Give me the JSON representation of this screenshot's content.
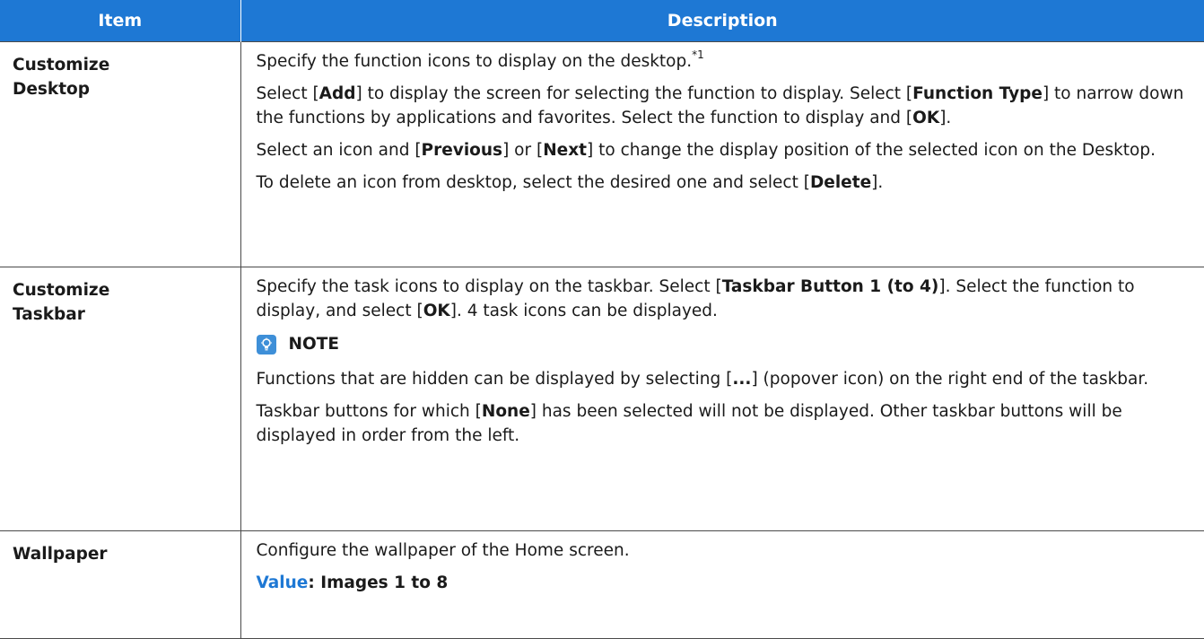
{
  "colors": {
    "header_bg": "#1e78d4",
    "value_label": "#1e78d4"
  },
  "header": {
    "item": "Item",
    "description": "Description"
  },
  "rows": [
    {
      "item_line1": "Customize",
      "item_line2": "Desktop",
      "p1": "Specify the function icons to display on the desktop.",
      "p1_sup": "*1",
      "p2_a": "Select [",
      "p2_b": "Add",
      "p2_c": "] to display the screen for selecting the function to display. Select [",
      "p2_d": "Function Type",
      "p2_e": "] to narrow down the functions by applications and favorites. Select the function to display and [",
      "p2_f": "OK",
      "p2_g": "].",
      "p3_a": "Select an icon and [",
      "p3_b": "Previous",
      "p3_c": "] or [",
      "p3_d": "Next",
      "p3_e": "] to change the display position of the selected icon on the Desktop.",
      "p4_a": "To delete an icon from desktop, select the desired one and select [",
      "p4_b": "Delete",
      "p4_c": "]."
    },
    {
      "item_line1": "Customize",
      "item_line2": "Taskbar",
      "p1_a": "Specify the task icons to display on the taskbar. Select [",
      "p1_b": "Taskbar Button 1 (to 4)",
      "p1_c": "]. Select the function to display, and select [",
      "p1_d": "OK",
      "p1_e": "]. 4 task icons can be displayed.",
      "note_icon": "lightbulb-note-icon",
      "note_label": "NOTE",
      "n1_a": "Functions that are hidden can be displayed by selecting [",
      "n1_b": "...",
      "n1_c": "] (popover icon) on the right end of the taskbar.",
      "n2_a": "Taskbar buttons for which [",
      "n2_b": "None",
      "n2_c": "] has been selected will not be displayed. Other taskbar buttons will be displayed in order from the left."
    },
    {
      "item": "Wallpaper",
      "p1": "Configure the wallpaper of the Home screen.",
      "value_label": "Value",
      "value_text": ": Images 1 to 8"
    }
  ]
}
